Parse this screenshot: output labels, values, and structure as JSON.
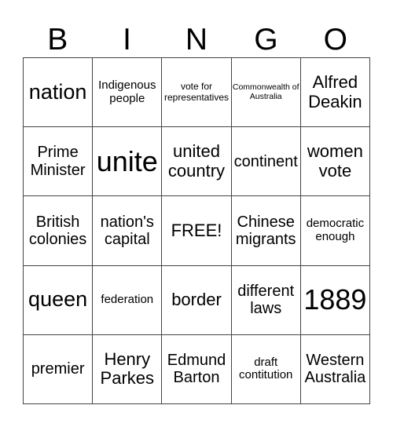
{
  "header": [
    "B",
    "I",
    "N",
    "G",
    "O"
  ],
  "cells": [
    [
      "nation",
      "Indigenous people",
      "vote for representatives",
      "Commonwealth of Australia",
      "Alfred Deakin"
    ],
    [
      "Prime Minister",
      "unite",
      "united country",
      "continent",
      "women vote"
    ],
    [
      "British colonies",
      "nation's capital",
      "FREE!",
      "Chinese migrants",
      "democratic enough"
    ],
    [
      "queen",
      "federation",
      "border",
      "different laws",
      "1889"
    ],
    [
      "premier",
      "Henry Parkes",
      "Edmund Barton",
      "draft contitution",
      "Western Australia"
    ]
  ]
}
